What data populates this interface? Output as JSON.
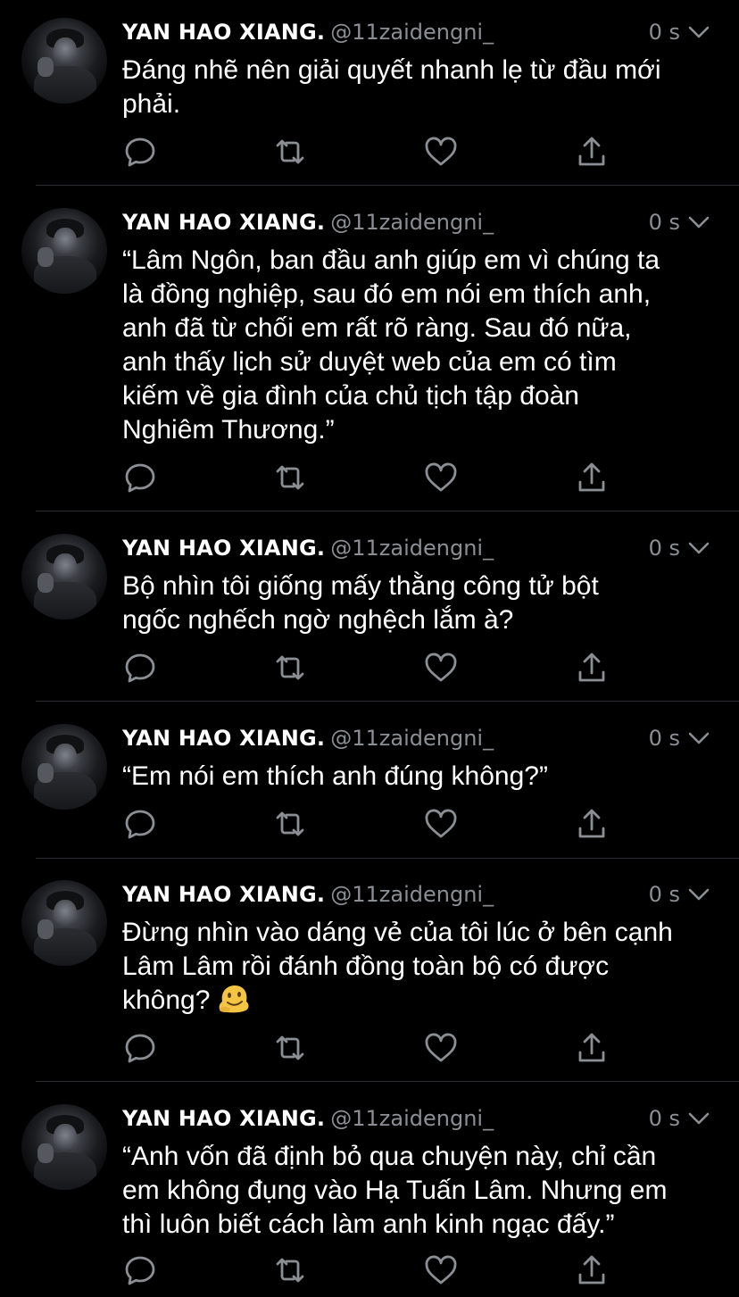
{
  "tweets": [
    {
      "name": "YAN HAO XIANG.",
      "handle": "@11zaidengni_",
      "time": "0 s",
      "text": "Đáng nhẽ nên giải quyết nhanh lẹ từ đầu mới\nphải."
    },
    {
      "name": "YAN HAO XIANG.",
      "handle": "@11zaidengni_",
      "time": "0 s",
      "text": "“Lâm Ngôn, ban đầu anh giúp em vì chúng ta\nlà đồng nghiệp, sau đó em nói em thích anh,\nanh đã từ chối em rất rõ ràng. Sau đó nữa,\nanh thấy lịch sử duyệt web của em có tìm\nkiếm về gia đình của chủ tịch tập đoàn\nNghiêm Thương.”"
    },
    {
      "name": "YAN HAO XIANG.",
      "handle": "@11zaidengni_",
      "time": "0 s",
      "text": "Bộ nhìn tôi giống mấy thằng công tử bột\nngốc nghếch ngờ nghệch lắm à?"
    },
    {
      "name": "YAN HAO XIANG.",
      "handle": "@11zaidengni_",
      "time": "0 s",
      "text": "“Em nói em thích anh đúng không?”"
    },
    {
      "name": "YAN HAO XIANG.",
      "handle": "@11zaidengni_",
      "time": "0 s",
      "text": "Đừng nhìn vào dáng vẻ của tôi lúc ở bên cạnh\nLâm Lâm rồi đánh đồng toàn bộ có được\nkhông?",
      "emoji": "melting-face-emoji"
    },
    {
      "name": "YAN HAO XIANG.",
      "handle": "@11zaidengni_",
      "time": "0 s",
      "text": "“Anh vốn đã định bỏ qua chuyện này, chỉ cần\nem không đụng vào Hạ Tuấn Lâm. Nhưng em\nthì luôn biết cách làm anh kinh ngạc đấy.”"
    }
  ],
  "icons": {
    "reply": "reply-icon",
    "retweet": "retweet-icon",
    "like": "heart-icon",
    "share": "share-icon",
    "more": "chevron-down-icon"
  },
  "colors": {
    "background": "#000000",
    "text": "#ffffff",
    "secondary": "#8b8f94",
    "divider": "#2b2e32"
  }
}
